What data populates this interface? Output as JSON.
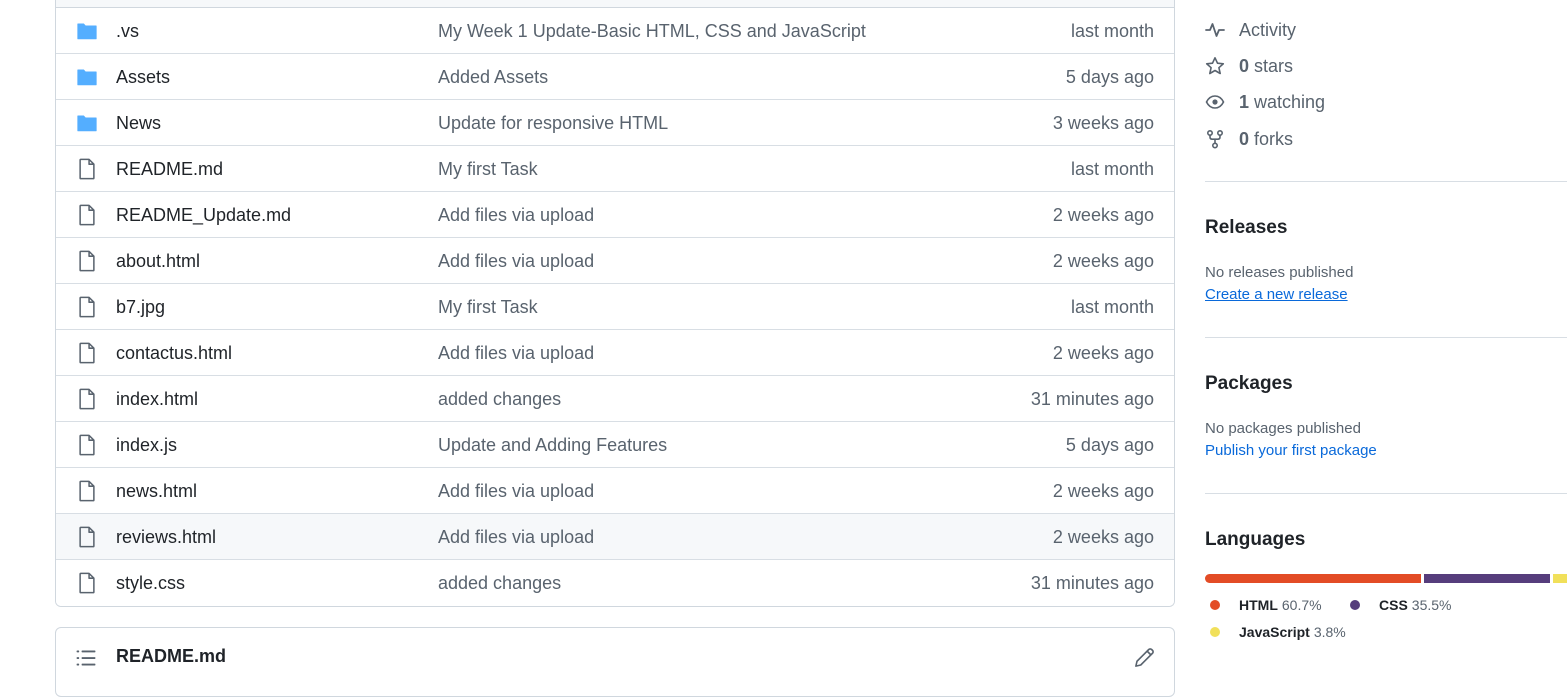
{
  "files": [
    {
      "name": ".vs",
      "type": "folder",
      "message": "My Week 1 Update-Basic HTML, CSS and JavaScript",
      "time": "last month"
    },
    {
      "name": "Assets",
      "type": "folder",
      "message": "Added Assets",
      "time": "5 days ago"
    },
    {
      "name": "News",
      "type": "folder",
      "message": "Update for responsive HTML",
      "time": "3 weeks ago"
    },
    {
      "name": "README.md",
      "type": "file",
      "message": "My first Task",
      "time": "last month"
    },
    {
      "name": "README_Update.md",
      "type": "file",
      "message": "Add files via upload",
      "time": "2 weeks ago"
    },
    {
      "name": "about.html",
      "type": "file",
      "message": "Add files via upload",
      "time": "2 weeks ago"
    },
    {
      "name": "b7.jpg",
      "type": "file",
      "message": "My first Task",
      "time": "last month"
    },
    {
      "name": "contactus.html",
      "type": "file",
      "message": "Add files via upload",
      "time": "2 weeks ago"
    },
    {
      "name": "index.html",
      "type": "file",
      "message": "added changes",
      "time": "31 minutes ago"
    },
    {
      "name": "index.js",
      "type": "file",
      "message": "Update and Adding Features",
      "time": "5 days ago"
    },
    {
      "name": "news.html",
      "type": "file",
      "message": "Add files via upload",
      "time": "2 weeks ago"
    },
    {
      "name": "reviews.html",
      "type": "file",
      "message": "Add files via upload",
      "time": "2 weeks ago",
      "hovered": true
    },
    {
      "name": "style.css",
      "type": "file",
      "message": "added changes",
      "time": "31 minutes ago"
    }
  ],
  "readme": {
    "title": "README.md"
  },
  "sidebar": {
    "activity": "Activity",
    "stars": {
      "count": "0",
      "label": " stars"
    },
    "watching": {
      "count": "1",
      "label": " watching"
    },
    "forks": {
      "count": "0",
      "label": " forks"
    },
    "releases": {
      "title": "Releases",
      "empty": "No releases published",
      "link": "Create a new release"
    },
    "packages": {
      "title": "Packages",
      "empty": "No packages published",
      "link": "Publish your first package"
    },
    "languages": {
      "title": "Languages",
      "items": [
        {
          "name": "HTML",
          "percent": "60.7%",
          "value": 60.7,
          "color": "#e34c26"
        },
        {
          "name": "CSS",
          "percent": "35.5%",
          "value": 35.5,
          "color": "#563d7c"
        },
        {
          "name": "JavaScript",
          "percent": "3.8%",
          "value": 3.8,
          "color": "#f1e05a"
        }
      ]
    }
  },
  "colors": {
    "folder": "#54aeff",
    "link": "#0969da",
    "muted": "#59636e"
  },
  "icons": {
    "folder": "folder-icon",
    "file": "file-icon"
  }
}
